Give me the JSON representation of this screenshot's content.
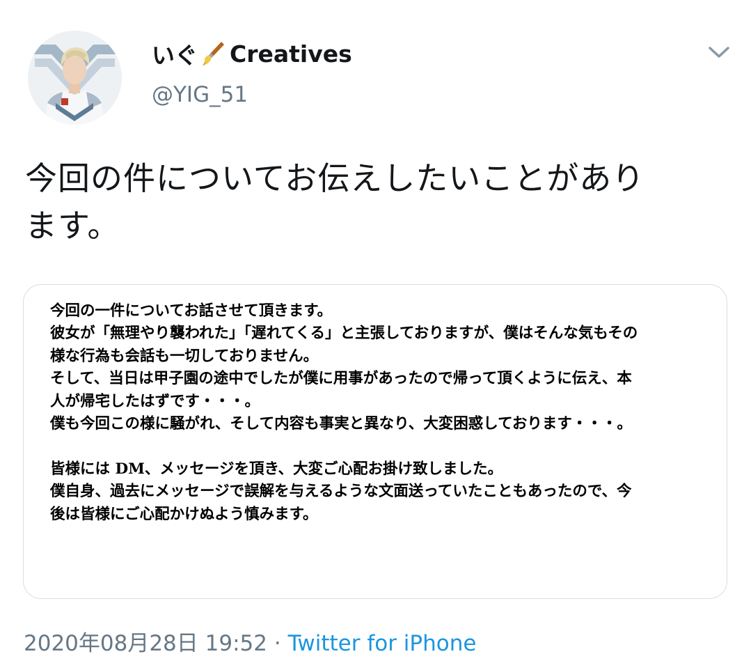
{
  "tweet": {
    "user": {
      "display_name": "いぐ",
      "display_name_emoji": "paintbrush-emoji",
      "display_name_suffix": "Creatives",
      "handle": "@YIG_51"
    },
    "text_line1": "今回の件についてお伝えしたいことがあり",
    "text_line2": "ます。",
    "image_statement": {
      "lines": [
        "今回の一件についてお話させて頂きます。",
        "彼女が「無理やり襲われた」「遅れてくる」と主張しておりますが、僕はそんな気もその",
        "様な行為も会話も一切しておりません。",
        "そして、当日は甲子園の途中でしたが僕に用事があったので帰って頂くように伝え、本",
        "人が帰宅したはずです・・・。",
        "僕も今回この様に騒がれ、そして内容も事実と異なり、大変困惑しております・・・。",
        "",
        "皆様には DM、メッセージを頂き、大変ご心配お掛け致しました。",
        "僕自身、過去にメッセージで誤解を与えるような文面送っていたこともあったので、今",
        "後は皆様にご心配かけぬよう慎みます。"
      ]
    },
    "timestamp": "2020年08月28日 19:52",
    "separator": "·",
    "source": "Twitter for iPhone"
  },
  "colors": {
    "text_primary": "#14171a",
    "text_secondary": "#657786",
    "link": "#1b95e0",
    "border": "#d8dfe5"
  },
  "icons": {
    "menu": "chevron-down-icon",
    "avatar": "avatar-photo"
  }
}
